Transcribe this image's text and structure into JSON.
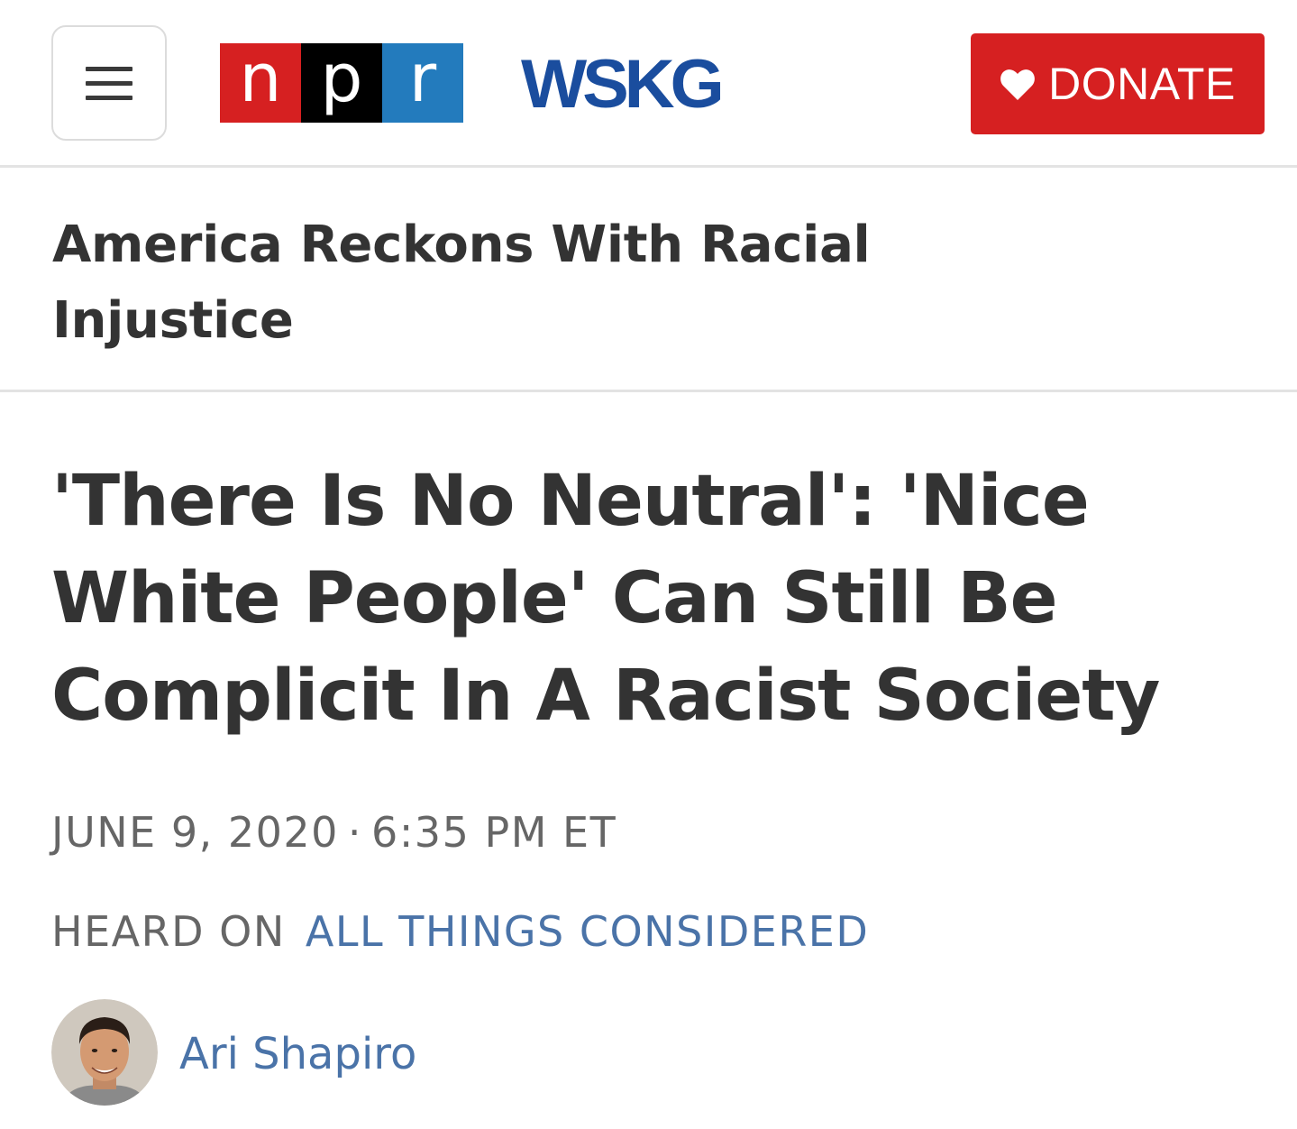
{
  "header": {
    "menu_icon": "hamburger-menu-icon",
    "npr_logo": {
      "letters": [
        "n",
        "p",
        "r"
      ],
      "colors": [
        "#d62021",
        "#000000",
        "#237bbd"
      ]
    },
    "station_logo": "WSKG",
    "station_color": "#1a4d9e",
    "donate": {
      "label": "DONATE",
      "icon": "heart-icon",
      "color": "#d62021"
    }
  },
  "section": {
    "title": "America Reckons With Racial Injustice"
  },
  "article": {
    "headline": "'There Is No Neutral': 'Nice White People' Can Still Be Complicit In A Racist Society",
    "date": "JUNE 9, 2020",
    "separator": "·",
    "time": "6:35 PM ET",
    "heard_on_prefix": "HEARD ON",
    "program": "ALL THINGS CONSIDERED",
    "link_color": "#4a73a8",
    "author": {
      "name": "Ari Shapiro",
      "avatar_icon": "author-avatar"
    }
  }
}
